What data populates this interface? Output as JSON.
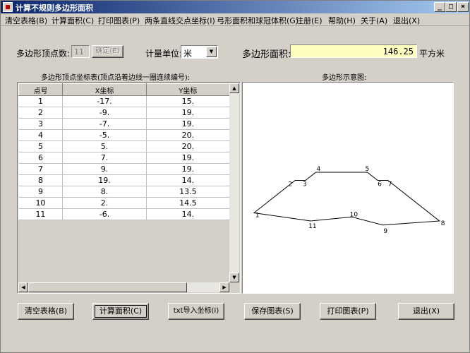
{
  "window": {
    "title": "计算不规则多边形面积"
  },
  "menu": [
    {
      "label": "清空表格(B)",
      "name": "menu-clear-table"
    },
    {
      "label": "计算面积(C)",
      "name": "menu-calc-area"
    },
    {
      "label": "打印图表(P)",
      "name": "menu-print-chart"
    },
    {
      "label": "两条直线交点坐标(I)",
      "name": "menu-line-intersection"
    },
    {
      "label": "弓形面积和球冠体积(G)",
      "name": "menu-arc-area"
    },
    {
      "label": "注册(E)",
      "name": "menu-register"
    },
    {
      "label": "帮助(H)",
      "name": "menu-help"
    },
    {
      "label": "关于(A)",
      "name": "menu-about"
    },
    {
      "label": "退出(X)",
      "name": "menu-exit"
    }
  ],
  "vertex_count": {
    "label": "多边形顶点数:",
    "value": "11",
    "confirm_label": "确定(E)"
  },
  "unit": {
    "label": "计量单位:",
    "value": "米"
  },
  "area": {
    "label": "多边形面积:",
    "value": "146.25",
    "unit": "平方米"
  },
  "table": {
    "caption": "多边形顶点坐标表(顶点沿着边线一圈连续编号):",
    "headers": [
      "点号",
      "X坐标",
      "Y坐标"
    ],
    "rows": [
      [
        "1",
        "-17.",
        "15."
      ],
      [
        "2",
        "-9.",
        "19."
      ],
      [
        "3",
        "-7.",
        "19."
      ],
      [
        "4",
        "-5.",
        "20."
      ],
      [
        "5",
        "5.",
        "20."
      ],
      [
        "6",
        "7.",
        "19."
      ],
      [
        "7",
        "9.",
        "19."
      ],
      [
        "8",
        "19.",
        "14."
      ],
      [
        "9",
        "8.",
        "13.5"
      ],
      [
        "10",
        "2.",
        "14.5"
      ],
      [
        "11",
        "-6.",
        "14."
      ]
    ]
  },
  "diagram": {
    "caption": "多边形示意图:",
    "points": [
      {
        "label": "1",
        "x": -17,
        "y": 15
      },
      {
        "label": "2",
        "x": -9,
        "y": 19
      },
      {
        "label": "3",
        "x": -7,
        "y": 19
      },
      {
        "label": "4",
        "x": -5,
        "y": 20
      },
      {
        "label": "5",
        "x": 5,
        "y": 20
      },
      {
        "label": "6",
        "x": 7,
        "y": 19
      },
      {
        "label": "7",
        "x": 9,
        "y": 19
      },
      {
        "label": "8",
        "x": 19,
        "y": 14
      },
      {
        "label": "9",
        "x": 8,
        "y": 13.5
      },
      {
        "label": "10",
        "x": 2,
        "y": 14.5
      },
      {
        "label": "11",
        "x": -6,
        "y": 14
      }
    ]
  },
  "buttons": {
    "clear": "清空表格(B)",
    "calc": "计算面积(C)",
    "import": "txt导入坐标(I)",
    "save": "保存图表(S)",
    "print": "打印图表(P)",
    "exit": "退出(X)"
  },
  "colors": {
    "titlebar_start": "#0a246a",
    "area_field": "#ffffc0"
  }
}
